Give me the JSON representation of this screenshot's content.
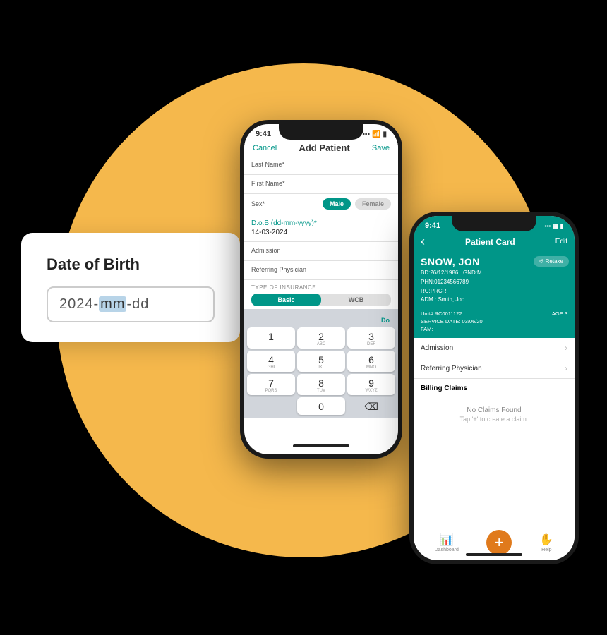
{
  "background": {
    "color": "#000000",
    "circle_color": "#F5B84C"
  },
  "dob_card": {
    "title": "Date of Birth",
    "input_value": "2024-mm-dd",
    "input_pre": "2024-",
    "input_highlight": "mm",
    "input_post": "-dd"
  },
  "phone1": {
    "status_bar": {
      "time": "9:41",
      "signal": "●●●",
      "wifi": "wifi",
      "battery": "battery"
    },
    "nav": {
      "cancel": "Cancel",
      "title": "Add Patient",
      "save": "Save"
    },
    "fields": [
      {
        "label": "Last Name*",
        "value": ""
      },
      {
        "label": "First Name*",
        "value": ""
      }
    ],
    "sex_label": "Sex*",
    "sex_options": [
      "Male",
      "Female"
    ],
    "sex_active": "Male",
    "dob_label": "D.o.B (dd-mm-yyyy)*",
    "dob_value": "14-03-2024",
    "admission_label": "Admission",
    "referring_label": "Referring Physician",
    "insurance_section_label": "TYPE OF INSURANCE",
    "insurance_options": [
      "Basic",
      "WCB"
    ],
    "insurance_active": "Basic",
    "keypad_do": "Do",
    "keys": [
      {
        "main": "1",
        "sub": ""
      },
      {
        "main": "2",
        "sub": "ABC"
      },
      {
        "main": "3",
        "sub": "DEF"
      },
      {
        "main": "4",
        "sub": "GHI"
      },
      {
        "main": "5",
        "sub": "JKL"
      },
      {
        "main": "6",
        "sub": "MNO"
      },
      {
        "main": "7",
        "sub": "PQRS"
      },
      {
        "main": "8",
        "sub": "TUV"
      },
      {
        "main": "9",
        "sub": "WXYZ"
      },
      {
        "main": "0",
        "sub": ""
      }
    ]
  },
  "phone2": {
    "status_bar": {
      "time": "9:41",
      "signal": "●●●",
      "wifi": "wifi",
      "battery": "battery"
    },
    "nav": {
      "back": "‹",
      "title": "Patient Card",
      "edit": "Edit"
    },
    "patient": {
      "name": "SNOW, JON",
      "bd": "BD:26/12/1986",
      "gnd": "GND:M",
      "phn": "PHN:01234566789",
      "rc": "RC:PRCR",
      "adm": "ADM : Smith, Joo",
      "unit": "Unit#:RC0011122",
      "service_date": "SERVICE DATE: 03/06/20",
      "fam": "FAM:",
      "age": "AGE:3"
    },
    "retake_label": "↺ Retake",
    "sections": {
      "admission": "Admission",
      "referring_physician": "Referring Physician"
    },
    "billing": {
      "title": "Billing Claims",
      "no_claims": "No Claims Found",
      "tap_hint": "Tap '+' to create a claim."
    },
    "bottom_nav": {
      "dashboard": "Dashboard",
      "add": "+",
      "help": "Help"
    }
  }
}
